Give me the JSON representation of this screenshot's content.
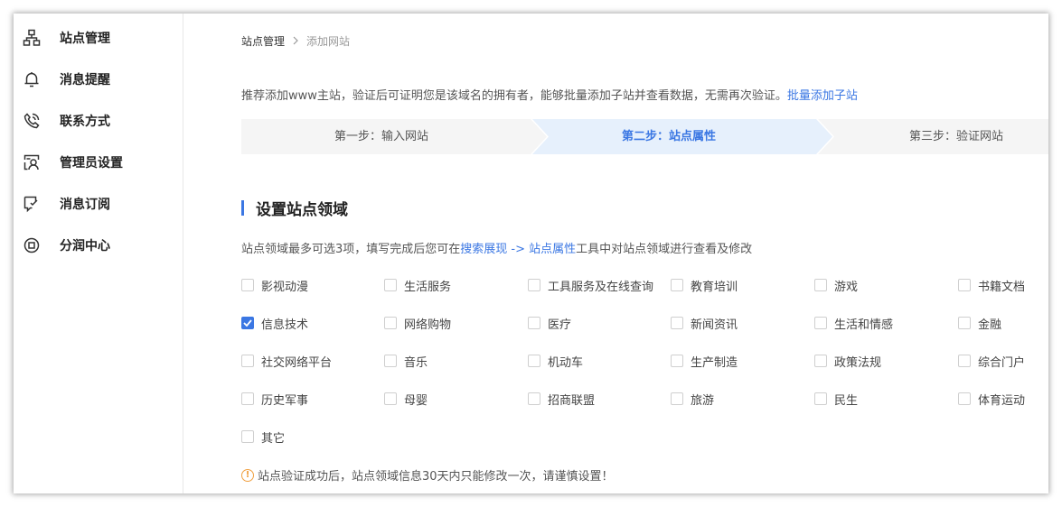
{
  "sidebar": {
    "items": [
      {
        "label": "站点管理",
        "icon": "sitemap-icon"
      },
      {
        "label": "消息提醒",
        "icon": "bell-icon"
      },
      {
        "label": "联系方式",
        "icon": "phone-icon"
      },
      {
        "label": "管理员设置",
        "icon": "admin-user-icon"
      },
      {
        "label": "消息订阅",
        "icon": "subscribe-message-icon"
      },
      {
        "label": "分润中心",
        "icon": "revenue-share-icon"
      }
    ]
  },
  "breadcrumb": {
    "parent": "站点管理",
    "current": "添加网站",
    "separator": ">"
  },
  "intro": {
    "text": "推荐添加www主站，验证后可证明您是该域名的拥有者，能够批量添加子站并查看数据，无需再次验证。",
    "link": "批量添加子站"
  },
  "steps": {
    "items": [
      "第一步：输入网站",
      "第二步：站点属性",
      "第三步：验证网站"
    ],
    "active_index": 1
  },
  "section": {
    "title": "设置站点领域",
    "desc_prefix": "站点领域最多可选3项，填写完成后您可在",
    "desc_link": "搜索展现 -> 站点属性",
    "desc_suffix": "工具中对站点领域进行查看及修改"
  },
  "categories": [
    {
      "label": "影视动漫",
      "checked": false
    },
    {
      "label": "生活服务",
      "checked": false
    },
    {
      "label": "工具服务及在线查询",
      "checked": false
    },
    {
      "label": "教育培训",
      "checked": false
    },
    {
      "label": "游戏",
      "checked": false
    },
    {
      "label": "书籍文档",
      "checked": false
    },
    {
      "label": "信息技术",
      "checked": true
    },
    {
      "label": "网络购物",
      "checked": false
    },
    {
      "label": "医疗",
      "checked": false
    },
    {
      "label": "新闻资讯",
      "checked": false
    },
    {
      "label": "生活和情感",
      "checked": false
    },
    {
      "label": "金融",
      "checked": false
    },
    {
      "label": "社交网络平台",
      "checked": false
    },
    {
      "label": "音乐",
      "checked": false
    },
    {
      "label": "机动车",
      "checked": false
    },
    {
      "label": "生产制造",
      "checked": false
    },
    {
      "label": "政策法规",
      "checked": false
    },
    {
      "label": "综合门户",
      "checked": false
    },
    {
      "label": "历史军事",
      "checked": false
    },
    {
      "label": "母婴",
      "checked": false
    },
    {
      "label": "招商联盟",
      "checked": false
    },
    {
      "label": "旅游",
      "checked": false
    },
    {
      "label": "民生",
      "checked": false
    },
    {
      "label": "体育运动",
      "checked": false
    },
    {
      "label": "其它",
      "checked": false
    }
  ],
  "warning": {
    "icon": "!",
    "text": "站点验证成功后，站点领域信息30天内只能修改一次，请谨慎设置！"
  },
  "colors": {
    "accent": "#3b77e3",
    "active_step_bg": "#e6f0fc",
    "step_bg": "#f5f5f5",
    "warning": "#f0a040"
  }
}
